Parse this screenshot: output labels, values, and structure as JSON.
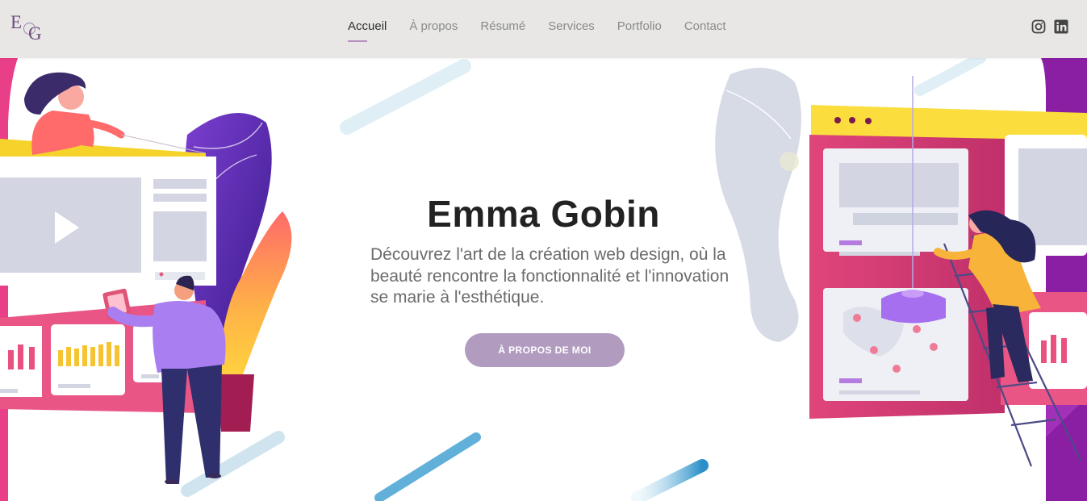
{
  "brand": {
    "logo_text_1": "E",
    "logo_text_2": "G"
  },
  "nav": {
    "items": [
      {
        "label": "Accueil",
        "active": true
      },
      {
        "label": "À propos"
      },
      {
        "label": "Résumé"
      },
      {
        "label": "Services"
      },
      {
        "label": "Portfolio"
      },
      {
        "label": "Contact"
      }
    ]
  },
  "social": {
    "icons": [
      "instagram-icon",
      "linkedin-icon"
    ]
  },
  "hero": {
    "title": "Emma Gobin",
    "subtitle": "Découvrez l'art de la création web design, où la beauté rencontre la fonctionnalité et l'innovation se marie à l'esthétique.",
    "cta_label": "À PROPOS DE MOI"
  },
  "colors": {
    "header_bg": "#e8e7e6",
    "accent": "#b19cc0",
    "title": "#222222",
    "subtitle": "#6b6b6b"
  }
}
